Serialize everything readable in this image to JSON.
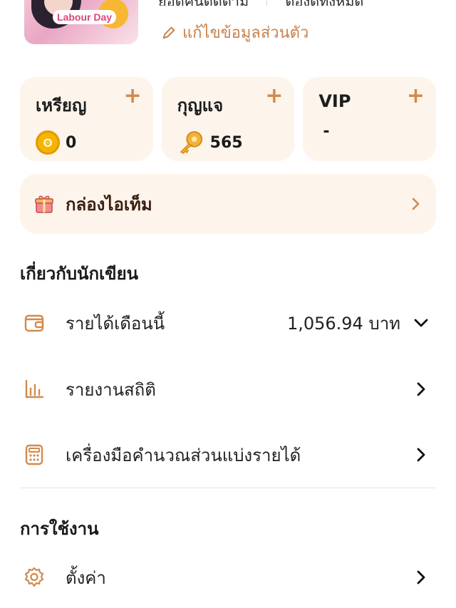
{
  "profile": {
    "avatar_badge": "Labour Day",
    "stat_left": "ยอดคนติดตาม",
    "stat_right": "ต้องดูทั้งหมด",
    "edit_label": "แก้ไขข้อมูลส่วนตัว"
  },
  "wallet": [
    {
      "title": "เหรียญ",
      "value": "0",
      "icon": "coin-icon"
    },
    {
      "title": "กุญแจ",
      "value": "565",
      "icon": "key-icon"
    },
    {
      "title": "VIP",
      "value": "-",
      "icon": ""
    }
  ],
  "item_box": {
    "label": "กล่องไอเท็ม",
    "icon": "gift-icon"
  },
  "writer_section": {
    "title": "เกี่ยวกับนักเขียน",
    "rows": [
      {
        "label": "รายได้เดือนนี้",
        "value": "1,056.94 บาท",
        "icon": "wallet-icon",
        "trailing": "chevron-down-icon"
      },
      {
        "label": "รายงานสถิติ",
        "icon": "bar-chart-icon",
        "trailing": "chevron-right-icon"
      },
      {
        "label": "เครื่องมือคำนวณส่วนแบ่งรายได้",
        "icon": "calculator-icon",
        "trailing": "chevron-right-icon"
      }
    ]
  },
  "usage_section": {
    "title": "การใช้งาน",
    "rows": [
      {
        "label": "ตั้งค่า",
        "icon": "gear-icon",
        "trailing": "chevron-right-icon"
      }
    ]
  },
  "colors": {
    "accent": "#c8824d",
    "card_bg": "#fdf4ec"
  }
}
